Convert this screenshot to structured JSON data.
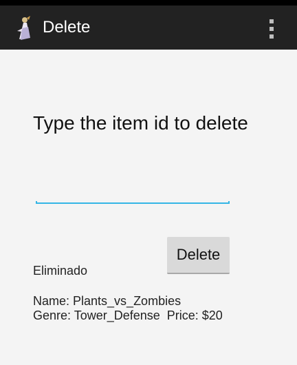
{
  "action_bar": {
    "title": "Delete",
    "icon": "app-character-icon",
    "overflow_icon": "overflow-menu-icon"
  },
  "form": {
    "prompt": "Type the item id to delete",
    "input_value": "",
    "input_placeholder": "",
    "delete_button": "Delete"
  },
  "result": {
    "status": "Eliminado",
    "name_line": "Name: Plants_vs_Zombies",
    "genre_price_line": "Genre: Tower_Defense  Price: $20"
  },
  "colors": {
    "action_bar_bg": "#222222",
    "accent": "#33b5e5",
    "button_bg": "#d9d9d9"
  }
}
